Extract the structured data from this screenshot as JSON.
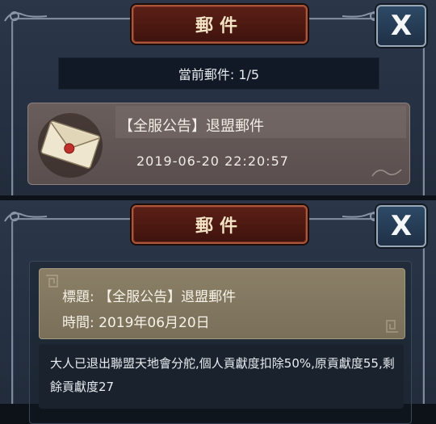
{
  "top_window": {
    "title": "郵件",
    "close_label": "X",
    "mail_count": "當前郵件: 1/5",
    "mail_item": {
      "subject": "【全服公告】退盟郵件",
      "date": "2019-06-20  22:20:57"
    }
  },
  "bottom_window": {
    "title": "郵件",
    "close_label": "X",
    "detail": {
      "subject_line": "標題: 【全服公告】退盟郵件",
      "time_line": "時間: 2019年06月20日",
      "body": "大人已退出聯盟天地會分舵,個人貢獻度扣除50%,原貢獻度55,剩餘貢獻度27"
    }
  },
  "colors": {
    "title_plate": "#5b1f16",
    "close_button": "#2d4a66",
    "mail_item_bg": "#6a5e5c",
    "detail_header_bg": "#8a7f66"
  },
  "icons": [
    "envelope-icon",
    "close-icon",
    "scroll-ornament-icon",
    "cloud-swirl-icon"
  ]
}
